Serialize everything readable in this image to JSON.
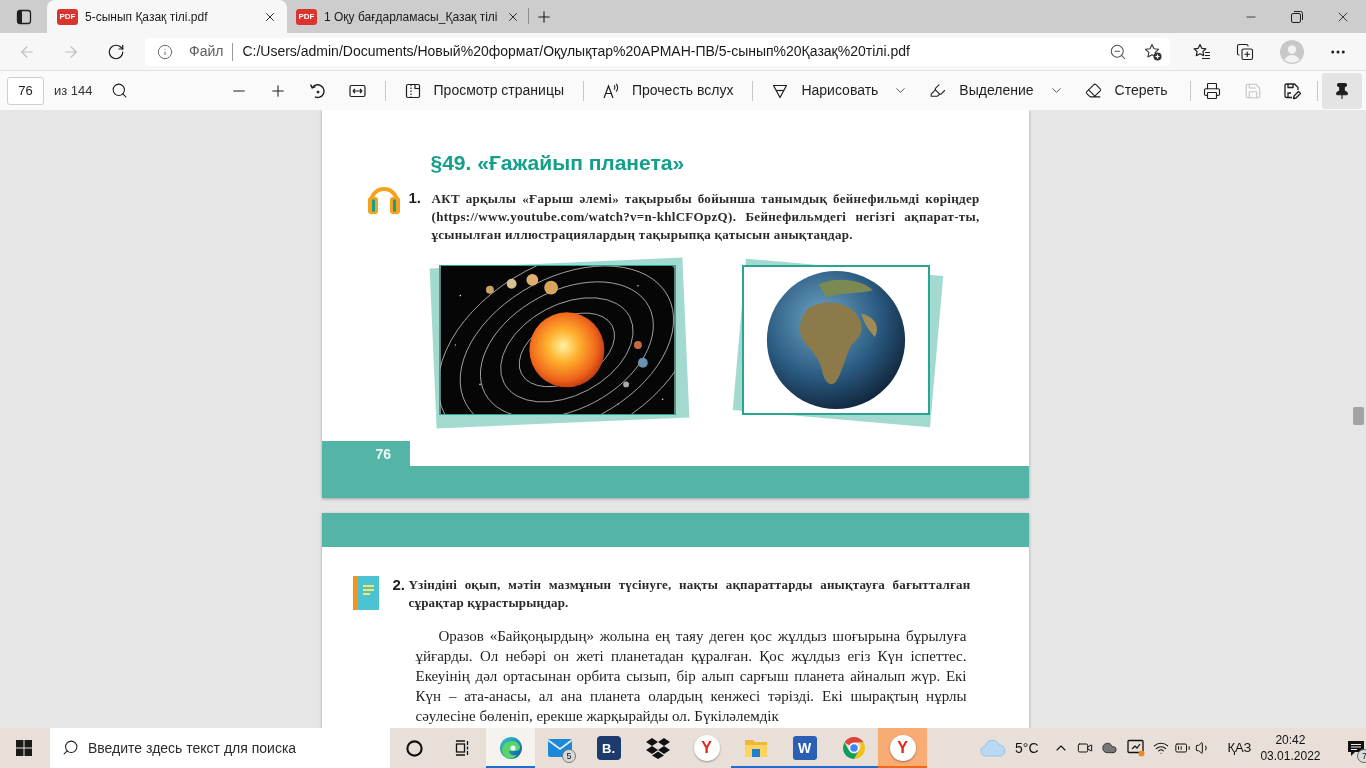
{
  "browser": {
    "tabs": [
      {
        "favicon_text": "PDF",
        "title": "5-сынып Қазақ тілі.pdf",
        "selected": true
      },
      {
        "favicon_text": "PDF",
        "title": "1 Оқу бағдарламасы_Қазақ тілі",
        "selected": false
      }
    ],
    "address_bar": {
      "scheme": "Файл",
      "url": "C:/Users/admin/Documents/Новый%20формат/Оқулықтар%20АРМАН-ПВ/5-сынып%20Қазақ%20тілі.pdf"
    }
  },
  "pdf_toolbar": {
    "page_number": "76",
    "page_count": "из 144",
    "tools": [
      {
        "kind": "page_view",
        "label": "Просмотр страницы",
        "dropdown": false
      },
      {
        "kind": "read_aloud",
        "label": "Прочесть вслух",
        "dropdown": false
      },
      {
        "kind": "draw",
        "label": "Нарисовать",
        "dropdown": true
      },
      {
        "kind": "highlight",
        "label": "Выделение",
        "dropdown": true
      },
      {
        "kind": "erase",
        "label": "Стереть",
        "dropdown": false
      }
    ],
    "save_disabled": true,
    "pinned": true
  },
  "document": {
    "page_1": {
      "heading": "§49. «Ғажайып планета»",
      "task_number": "1.",
      "task_text": "АКТ арқылы «Ғарыш әлемі» тақырыбы бойынша танымдық бейнефильмді көріңдер (https://www.youtube.com/watch?v=n-khlCFOpzQ). Бейнефильмдегі негізгі ақпарат-ты, ұсынылған иллюстрациялардың тақырыпқа қатысын анықтаңдар.",
      "page_number": "76"
    },
    "page_2": {
      "task_number": "2.",
      "task_text": "Үзіндіні оқып, мәтін мазмұнын түсінуге, нақты ақпараттарды анықтауға бағытталған сұрақтар құрастырыңдар.",
      "paragraph": "Оразов «Байқоңырдың» жолына ең таяу деген қос жұлдыз шоғырына бұрылуға ұйғарды. Ол небәрі он жеті планетадан құралған. Қос жұлдыз егіз Күн іспеттес. Екеуінің дәл ортасынан орбита сызып, бір алып сарғыш планета айналып жүр. Екі Күн – ата-анасы, ал ана планета олардың кенжесі тәрізді. Екі шырақтың нұрлы сәулесіне бөленіп, ерекше жарқырайды ол. Бүкіләлемдік"
    }
  },
  "taskbar": {
    "search_placeholder": "Введите здесь текст для поиска",
    "apps": [
      {
        "kind": "edge",
        "running": true,
        "focused": true,
        "flashing": false
      },
      {
        "kind": "mail",
        "running": false,
        "focused": false,
        "flashing": false,
        "badge": "5"
      },
      {
        "kind": "bookmate",
        "running": false,
        "focused": false,
        "flashing": false,
        "label": "B."
      },
      {
        "kind": "dropbox",
        "running": false,
        "focused": false,
        "flashing": false
      },
      {
        "kind": "yandex",
        "running": false,
        "focused": false,
        "flashing": false,
        "label": "Y"
      },
      {
        "kind": "explorer",
        "running": true,
        "focused": false,
        "flashing": false
      },
      {
        "kind": "word",
        "running": true,
        "focused": false,
        "flashing": false,
        "label": "W"
      },
      {
        "kind": "chrome",
        "running": true,
        "focused": false,
        "flashing": false
      },
      {
        "kind": "yandex",
        "running": true,
        "focused": false,
        "flashing": true,
        "label": "Y"
      }
    ],
    "weather": "5°C",
    "language": "ҚАЗ",
    "time": "20:42",
    "date": "03.01.2022",
    "notifications": "7"
  }
}
